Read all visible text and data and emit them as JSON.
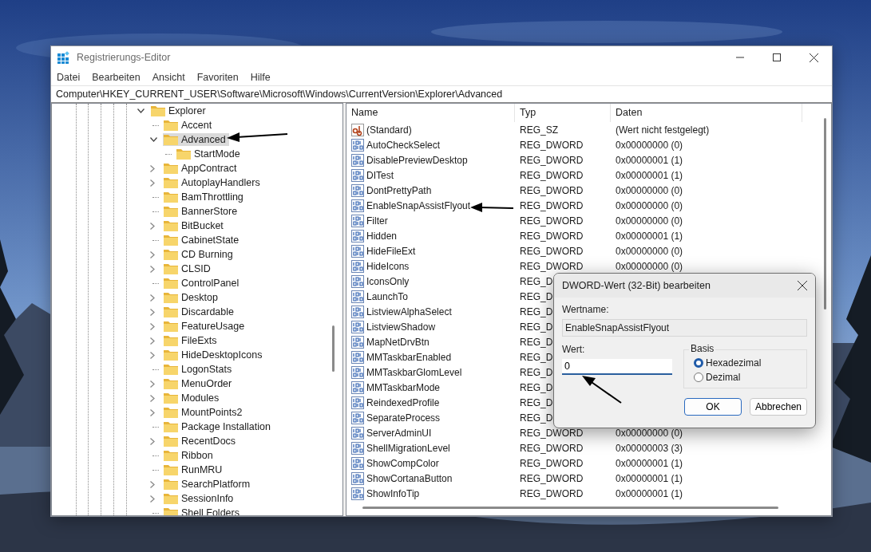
{
  "window": {
    "title": "Registrierungs-Editor",
    "menu": [
      "Datei",
      "Bearbeiten",
      "Ansicht",
      "Favoriten",
      "Hilfe"
    ],
    "address": "Computer\\HKEY_CURRENT_USER\\Software\\Microsoft\\Windows\\CurrentVersion\\Explorer\\Advanced"
  },
  "tree": {
    "items": [
      {
        "label": "Explorer",
        "has_children": true,
        "expanded": true,
        "selected": false,
        "children": [
          {
            "label": "Accent",
            "has_children": false,
            "expanded": false,
            "selected": false
          },
          {
            "label": "Advanced",
            "has_children": true,
            "expanded": true,
            "selected": true,
            "children": [
              {
                "label": "StartMode",
                "has_children": false,
                "expanded": false,
                "selected": false
              }
            ]
          },
          {
            "label": "AppContract",
            "has_children": true,
            "expanded": false,
            "selected": false
          },
          {
            "label": "AutoplayHandlers",
            "has_children": true,
            "expanded": false,
            "selected": false
          },
          {
            "label": "BamThrottling",
            "has_children": false,
            "expanded": false,
            "selected": false
          },
          {
            "label": "BannerStore",
            "has_children": false,
            "expanded": false,
            "selected": false
          },
          {
            "label": "BitBucket",
            "has_children": true,
            "expanded": false,
            "selected": false
          },
          {
            "label": "CabinetState",
            "has_children": false,
            "expanded": false,
            "selected": false
          },
          {
            "label": "CD Burning",
            "has_children": true,
            "expanded": false,
            "selected": false
          },
          {
            "label": "CLSID",
            "has_children": true,
            "expanded": false,
            "selected": false
          },
          {
            "label": "ControlPanel",
            "has_children": false,
            "expanded": false,
            "selected": false
          },
          {
            "label": "Desktop",
            "has_children": true,
            "expanded": false,
            "selected": false
          },
          {
            "label": "Discardable",
            "has_children": true,
            "expanded": false,
            "selected": false
          },
          {
            "label": "FeatureUsage",
            "has_children": true,
            "expanded": false,
            "selected": false
          },
          {
            "label": "FileExts",
            "has_children": true,
            "expanded": false,
            "selected": false
          },
          {
            "label": "HideDesktopIcons",
            "has_children": true,
            "expanded": false,
            "selected": false
          },
          {
            "label": "LogonStats",
            "has_children": false,
            "expanded": false,
            "selected": false
          },
          {
            "label": "MenuOrder",
            "has_children": true,
            "expanded": false,
            "selected": false
          },
          {
            "label": "Modules",
            "has_children": true,
            "expanded": false,
            "selected": false
          },
          {
            "label": "MountPoints2",
            "has_children": true,
            "expanded": false,
            "selected": false
          },
          {
            "label": "Package Installation",
            "has_children": false,
            "expanded": false,
            "selected": false
          },
          {
            "label": "RecentDocs",
            "has_children": true,
            "expanded": false,
            "selected": false
          },
          {
            "label": "Ribbon",
            "has_children": false,
            "expanded": false,
            "selected": false
          },
          {
            "label": "RunMRU",
            "has_children": false,
            "expanded": false,
            "selected": false
          },
          {
            "label": "SearchPlatform",
            "has_children": true,
            "expanded": false,
            "selected": false
          },
          {
            "label": "SessionInfo",
            "has_children": true,
            "expanded": false,
            "selected": false
          },
          {
            "label": "Shell Folders",
            "has_children": false,
            "expanded": false,
            "selected": false
          }
        ]
      }
    ]
  },
  "values": {
    "columns": [
      "Name",
      "Typ",
      "Daten"
    ],
    "rows": [
      {
        "kind": "string",
        "name": "(Standard)",
        "type": "REG_SZ",
        "data": "(Wert nicht festgelegt)"
      },
      {
        "kind": "binary",
        "name": "AutoCheckSelect",
        "type": "REG_DWORD",
        "data": "0x00000000 (0)"
      },
      {
        "kind": "binary",
        "name": "DisablePreviewDesktop",
        "type": "REG_DWORD",
        "data": "0x00000001 (1)"
      },
      {
        "kind": "binary",
        "name": "DITest",
        "type": "REG_DWORD",
        "data": "0x00000001 (1)"
      },
      {
        "kind": "binary",
        "name": "DontPrettyPath",
        "type": "REG_DWORD",
        "data": "0x00000000 (0)"
      },
      {
        "kind": "binary",
        "name": "EnableSnapAssistFlyout",
        "type": "REG_DWORD",
        "data": "0x00000000 (0)"
      },
      {
        "kind": "binary",
        "name": "Filter",
        "type": "REG_DWORD",
        "data": "0x00000000 (0)"
      },
      {
        "kind": "binary",
        "name": "Hidden",
        "type": "REG_DWORD",
        "data": "0x00000001 (1)"
      },
      {
        "kind": "binary",
        "name": "HideFileExt",
        "type": "REG_DWORD",
        "data": "0x00000000 (0)"
      },
      {
        "kind": "binary",
        "name": "HideIcons",
        "type": "REG_DWORD",
        "data": "0x00000000 (0)"
      },
      {
        "kind": "binary",
        "name": "IconsOnly",
        "type": "REG_D"
      },
      {
        "kind": "binary",
        "name": "LaunchTo",
        "type": "REG_D"
      },
      {
        "kind": "binary",
        "name": "ListviewAlphaSelect",
        "type": "REG_D"
      },
      {
        "kind": "binary",
        "name": "ListviewShadow",
        "type": "REG_D"
      },
      {
        "kind": "binary",
        "name": "MapNetDrvBtn",
        "type": "REG_D"
      },
      {
        "kind": "binary",
        "name": "MMTaskbarEnabled",
        "type": "REG_D"
      },
      {
        "kind": "binary",
        "name": "MMTaskbarGlomLevel",
        "type": "REG_D"
      },
      {
        "kind": "binary",
        "name": "MMTaskbarMode",
        "type": "REG_D"
      },
      {
        "kind": "binary",
        "name": "ReindexedProfile",
        "type": "REG_D"
      },
      {
        "kind": "binary",
        "name": "SeparateProcess",
        "type": "REG_D"
      },
      {
        "kind": "binary",
        "name": "ServerAdminUI",
        "type": "REG_DWORD",
        "data": "0x00000000 (0)"
      },
      {
        "kind": "binary",
        "name": "ShellMigrationLevel",
        "type": "REG_DWORD",
        "data": "0x00000003 (3)"
      },
      {
        "kind": "binary",
        "name": "ShowCompColor",
        "type": "REG_DWORD",
        "data": "0x00000001 (1)"
      },
      {
        "kind": "binary",
        "name": "ShowCortanaButton",
        "type": "REG_DWORD",
        "data": "0x00000001 (1)"
      },
      {
        "kind": "binary",
        "name": "ShowInfoTip",
        "type": "REG_DWORD",
        "data": "0x00000001 (1)"
      }
    ]
  },
  "dialog": {
    "title": "DWORD-Wert (32-Bit) bearbeiten",
    "name_label": "Wertname:",
    "name_value": "EnableSnapAssistFlyout",
    "value_label": "Wert:",
    "value": "0",
    "base_label": "Basis",
    "bases": [
      {
        "label": "Hexadezimal",
        "selected": true
      },
      {
        "label": "Dezimal",
        "selected": false
      }
    ],
    "buttons": [
      {
        "label": "OK",
        "default": true
      },
      {
        "label": "Abbrechen",
        "default": false
      }
    ]
  }
}
